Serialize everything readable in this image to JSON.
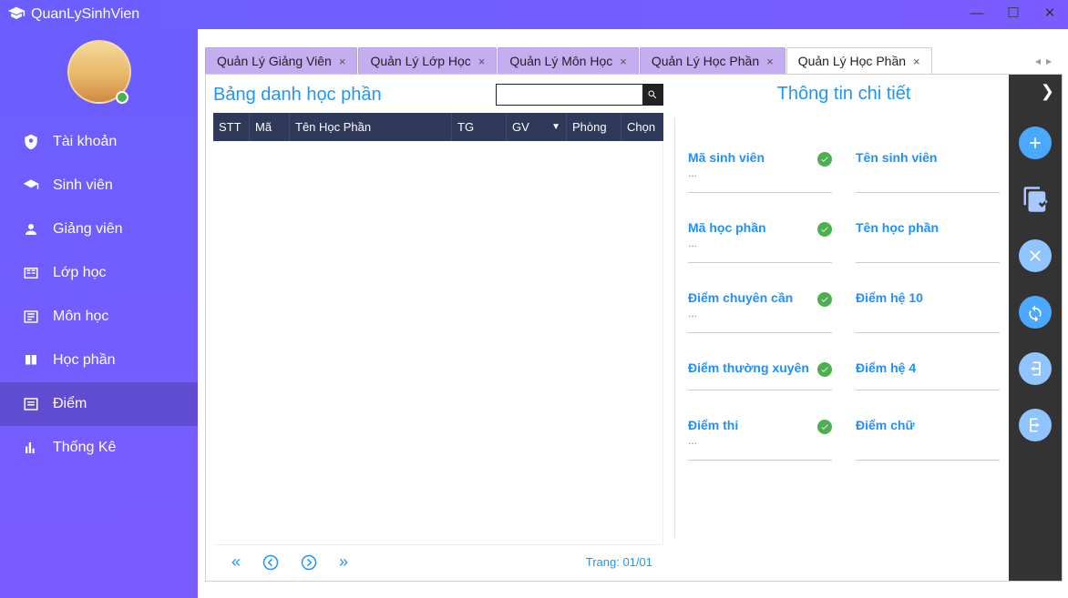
{
  "app_title": "QuanLySinhVien",
  "sidebar": {
    "items": [
      {
        "label": "Tài khoản"
      },
      {
        "label": "Sinh viên"
      },
      {
        "label": "Giảng viên"
      },
      {
        "label": "Lớp học"
      },
      {
        "label": "Môn học"
      },
      {
        "label": "Học phần"
      },
      {
        "label": "Điểm"
      },
      {
        "label": "Thống Kê"
      }
    ],
    "active_index": 6
  },
  "tabs": {
    "items": [
      {
        "label": "Quản Lý Giảng Viên"
      },
      {
        "label": "Quản Lý Lớp Học"
      },
      {
        "label": "Quản Lý Môn Học"
      },
      {
        "label": "Quản Lý Học Phần"
      },
      {
        "label": "Quản Lý Học Phần"
      }
    ],
    "active_index": 4
  },
  "left_pane": {
    "title": "Bảng danh học phần",
    "search_value": "",
    "columns": {
      "stt": "STT",
      "ma": "Mã",
      "ten": "Tên Học Phần",
      "tg": "TG",
      "gv": "GV",
      "phong": "Phòng",
      "chon": "Chọn"
    },
    "pager_label": "Trang: 01/01"
  },
  "right_pane": {
    "title": "Thông tin chi tiết",
    "fields": {
      "ma_sv": {
        "label": "Mã sinh viên",
        "value": "..."
      },
      "ten_sv": {
        "label": "Tên sinh viên",
        "value": ""
      },
      "ma_hp": {
        "label": "Mã học phần",
        "value": "..."
      },
      "ten_hp": {
        "label": "Tên học phần",
        "value": ""
      },
      "diem_cc": {
        "label": "Điểm chuyên cần",
        "value": "..."
      },
      "diem_h10": {
        "label": "Điểm hệ 10",
        "value": ""
      },
      "diem_tx": {
        "label": "Điểm thường xuyên",
        "value": ""
      },
      "diem_h4": {
        "label": "Điểm hệ 4",
        "value": ""
      },
      "diem_thi": {
        "label": "Điểm thi",
        "value": "..."
      },
      "diem_chu": {
        "label": "Điểm chữ",
        "value": ""
      }
    }
  }
}
